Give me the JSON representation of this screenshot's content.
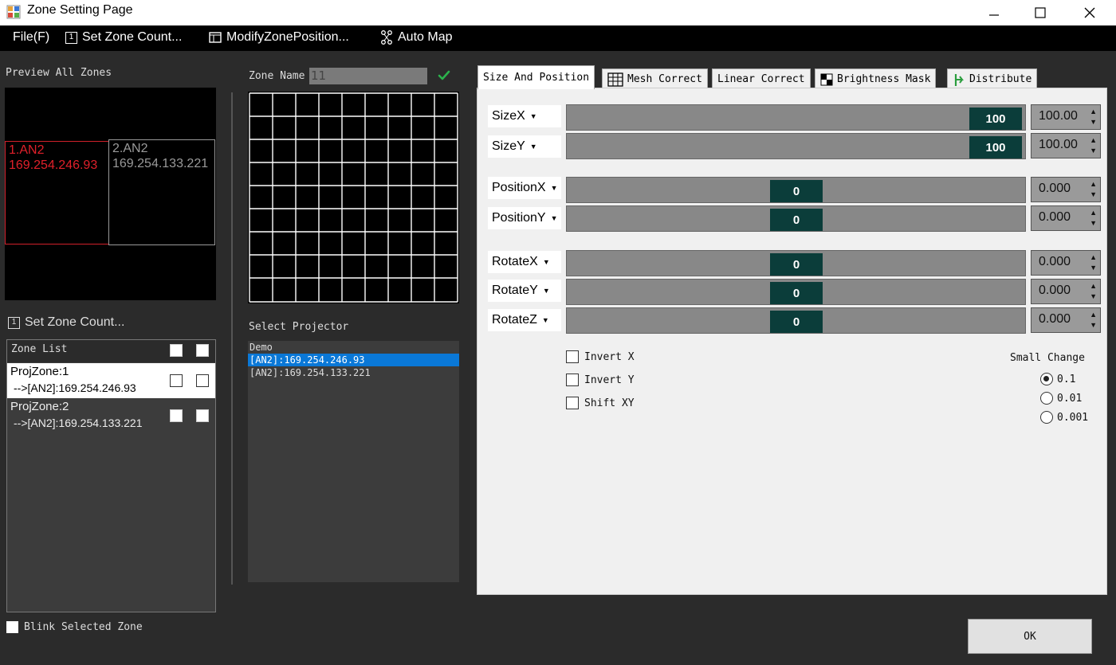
{
  "window": {
    "title": "Zone Setting Page"
  },
  "menu": {
    "file": "File(F)",
    "set_zone_count": "Set Zone Count...",
    "modify_zone_position": "ModifyZonePosition...",
    "auto_map": "Auto Map"
  },
  "preview": {
    "label": "Preview All Zones",
    "zones": [
      {
        "name": "1.AN2",
        "ip": "169.254.246.93",
        "color": "#e0202a"
      },
      {
        "name": "2.AN2",
        "ip": "169.254.133.221",
        "color": "#9a9a9a"
      }
    ]
  },
  "left": {
    "set_zone_count": "Set Zone Count...",
    "zone_list_header": "Zone List",
    "zones": [
      {
        "title": "ProjZone:1",
        "detail": "-->[AN2]:169.254.246.93"
      },
      {
        "title": "ProjZone:2",
        "detail": "-->[AN2]:169.254.133.221"
      }
    ],
    "blink_label": "Blink Selected Zone"
  },
  "middle": {
    "zone_name_label": "Zone Name",
    "zone_name_value": "11",
    "select_projector_label": "Select Projector",
    "projector_group": "Demo",
    "projectors": [
      "[AN2]:169.254.246.93",
      "[AN2]:169.254.133.221"
    ]
  },
  "tabs": {
    "size_position": "Size And Position",
    "mesh_correct": "Mesh Correct",
    "linear_correct": "Linear Correct",
    "brightness_mask": "Brightness Mask",
    "distribute": "Distribute"
  },
  "params": {
    "sizex": {
      "label": "SizeX",
      "slider": "100",
      "value": "100.00",
      "level": 1.0
    },
    "sizey": {
      "label": "SizeY",
      "slider": "100",
      "value": "100.00",
      "level": 1.0
    },
    "posx": {
      "label": "PositionX",
      "slider": "0",
      "value": "0.000",
      "level": 0.5
    },
    "posy": {
      "label": "PositionY",
      "slider": "0",
      "value": "0.000",
      "level": 0.5
    },
    "rotx": {
      "label": "RotateX",
      "slider": "0",
      "value": "0.000",
      "level": 0.5
    },
    "roty": {
      "label": "RotateY",
      "slider": "0",
      "value": "0.000",
      "level": 0.5
    },
    "rotz": {
      "label": "RotateZ",
      "slider": "0",
      "value": "0.000",
      "level": 0.5
    }
  },
  "options": {
    "invert_x": "Invert X",
    "invert_y": "Invert Y",
    "shift_xy": "Shift XY",
    "small_change_label": "Small Change",
    "small_change_options": [
      "0.1",
      "0.01",
      "0.001"
    ],
    "small_change_selected": "0.1"
  },
  "ok_label": "OK",
  "colors": {
    "selection": "#0a78d7",
    "slider_thumb": "#0b3d3a",
    "active_zone": "#e0202a",
    "check_green": "#2bb24c"
  }
}
